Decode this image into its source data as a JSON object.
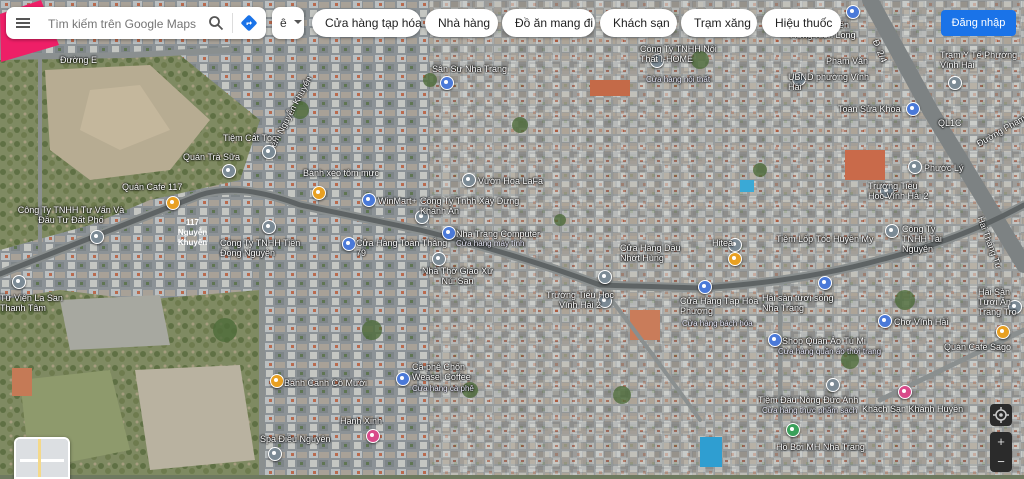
{
  "search": {
    "placeholder": "Tìm kiếm trên Google Maps"
  },
  "language": {
    "value": "ê"
  },
  "chips": [
    {
      "label": "Cửa hàng tạp hóa",
      "icon": "cart-icon"
    },
    {
      "label": "Nhà hàng",
      "icon": "restaurant-icon"
    },
    {
      "label": "Đồ ăn mang đi",
      "icon": "takeout-icon"
    },
    {
      "label": "Khách sạn",
      "icon": "hotel-icon"
    },
    {
      "label": "Trạm xăng",
      "icon": "gas-station-icon"
    },
    {
      "label": "Hiệu thuốc",
      "icon": "pharmacy-icon"
    }
  ],
  "signin": {
    "label": "Đăng nhập"
  },
  "highlight": {
    "line1": "117",
    "line2": "Nguyễn Khuyến",
    "color": "#ee1f67"
  },
  "zoom": {
    "in": "+",
    "out": "−"
  },
  "roads": {
    "duong_e": "Đường E",
    "nguyen_khuyen": "Hẻm Nguyễn Khuyến",
    "d2_4": "Đ. 2/4",
    "ql1c": "QL1C",
    "duong_phap": "Đường Phạm",
    "hai_thang_tu": "Hai Tháng Tư"
  },
  "places": [
    {
      "name": "Sân Sư Nha Trang",
      "icon": "blue"
    },
    {
      "name": "Công Ty TNHH Tư Vấn Và Đầu Tư Đất Phố",
      "icon": "gray"
    },
    {
      "name": "Quán Cafe 117",
      "icon": "orange"
    },
    {
      "name": "Tiệm Cắt Tóc",
      "icon": "gray"
    },
    {
      "name": "Quán Trà Sữa",
      "icon": "gray"
    },
    {
      "name": "Bánh xèo tôm mực",
      "icon": "orange"
    },
    {
      "name": "WinMart+",
      "icon": "blue"
    },
    {
      "name": "Công Ty Tnhh Xây Dựng Khánh An",
      "icon": "gray"
    },
    {
      "name": "Vườn Hoa LaFa",
      "icon": "gray"
    },
    {
      "name": "Công Ty TNHH Tiền Đông Nguyên",
      "icon": "gray"
    },
    {
      "name": "Cửa Hàng Toàn Thắng 79",
      "icon": "blue"
    },
    {
      "name": "Nha Trang Computer",
      "icon": "blue"
    },
    {
      "name": "Cửa hàng máy tính",
      "icon": ""
    },
    {
      "name": "Nhà Thờ Giáo Xứ Núi Sạn",
      "icon": "gray"
    },
    {
      "name": "Cửa Hàng Dầu Nhớt Hùng",
      "icon": "gray"
    },
    {
      "name": "Tiệm Lốp Tóc Huyền My",
      "icon": "gray"
    },
    {
      "name": "Hitea",
      "icon": "orange"
    },
    {
      "name": "Trường Tiểu Học Vĩnh Hải 2",
      "icon": "gray"
    },
    {
      "name": "Cửa Hàng Tạp Hóa Phượng",
      "icon": "blue"
    },
    {
      "name": "Cửa hàng bách hóa",
      "icon": ""
    },
    {
      "name": "Hải sản tươi sống Nha Trang",
      "icon": "blue"
    },
    {
      "name": "Chợ Vĩnh Hải",
      "icon": "blue"
    },
    {
      "name": "Quán Cafe Sago",
      "icon": "orange"
    },
    {
      "name": "Shop Quần Áo Tú Mi",
      "icon": "blue"
    },
    {
      "name": "Cửa hàng quần áo thời trang",
      "icon": ""
    },
    {
      "name": "Tư Viện La San Thanh Tâm",
      "icon": "gray"
    },
    {
      "name": "Cà phê Chốn Weasel Coffee",
      "icon": "blue"
    },
    {
      "name": "Cửa hàng cà phê",
      "icon": ""
    },
    {
      "name": "Bánh Canh Cô Mười",
      "icon": "orange"
    },
    {
      "name": "Hạnh Xinh",
      "icon": "pink"
    },
    {
      "name": "Spa Điều Nguyên",
      "icon": "gray"
    },
    {
      "name": "Tiệm Đầu Nông Đức Anh",
      "icon": "gray"
    },
    {
      "name": "Cửa hàng thực phẩm sạch",
      "icon": ""
    },
    {
      "name": "Khách Sạn Khánh Huyền",
      "icon": "pink"
    },
    {
      "name": "Hồ Bơi MH Nha Trang",
      "icon": "green"
    },
    {
      "name": "Công Ty TNHH Tài Nguyên",
      "icon": "gray"
    },
    {
      "name": "Trường Tiểu Học Vĩnh Hải 2",
      "icon": "gray"
    },
    {
      "name": "Phước Lý",
      "icon": "gray"
    },
    {
      "name": "Toàn Sửa Khóa",
      "icon": "blue"
    },
    {
      "name": "UBND phường Vĩnh Hải",
      "icon": "gray"
    },
    {
      "name": "Công Ty TNHH Nội Thất I-HOME",
      "icon": "gray"
    },
    {
      "name": "Cửa hàng nội thất",
      "icon": ""
    },
    {
      "name": "Nhà Sách Tiến Hưng Kiên Long",
      "icon": "blue"
    },
    {
      "name": "Trạm Y Tế Phường Vĩnh Hải",
      "icon": "gray"
    },
    {
      "name": "Hải Sản Tươi Ăn Trang Trọ",
      "icon": "gray"
    },
    {
      "name": "Phạm Văn",
      "icon": "gray"
    }
  ]
}
